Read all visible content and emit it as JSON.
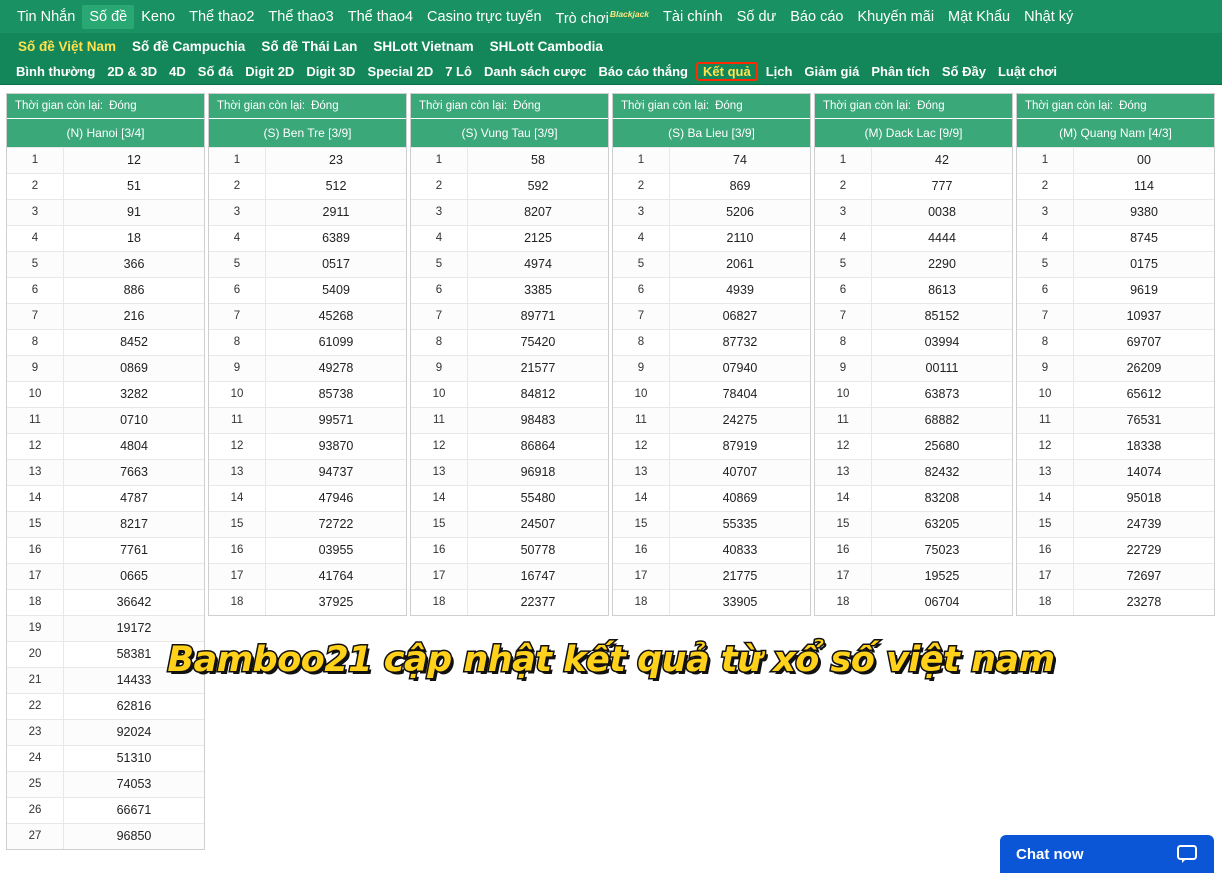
{
  "nav_primary": {
    "items": [
      {
        "label": "Tin Nhắn",
        "active": false
      },
      {
        "label": "Số đề",
        "active": true
      },
      {
        "label": "Keno",
        "active": false
      },
      {
        "label": "Thể thao2",
        "active": false
      },
      {
        "label": "Thể thao3",
        "active": false
      },
      {
        "label": "Thể thao4",
        "active": false
      },
      {
        "label": "Casino trực tuyến",
        "active": false
      },
      {
        "label": "Trò chơi",
        "badge": "Blackjack",
        "active": false
      },
      {
        "label": "Tài chính",
        "active": false
      },
      {
        "label": "Số dư",
        "active": false
      },
      {
        "label": "Báo cáo",
        "active": false
      },
      {
        "label": "Khuyến mãi",
        "active": false
      },
      {
        "label": "Mật Khẩu",
        "active": false
      },
      {
        "label": "Nhật ký",
        "active": false
      }
    ]
  },
  "nav_secondary": {
    "items": [
      {
        "label": "Số đề Việt Nam",
        "active": true
      },
      {
        "label": "Số đề Campuchia",
        "active": false
      },
      {
        "label": "Số đề Thái Lan",
        "active": false
      },
      {
        "label": "SHLott Vietnam",
        "active": false
      },
      {
        "label": "SHLott Cambodia",
        "active": false
      }
    ]
  },
  "nav_tertiary": {
    "items": [
      {
        "label": "Bình thường",
        "highlight": false
      },
      {
        "label": "2D & 3D",
        "highlight": false
      },
      {
        "label": "4D",
        "highlight": false
      },
      {
        "label": "Số đá",
        "highlight": false
      },
      {
        "label": "Digit 2D",
        "highlight": false
      },
      {
        "label": "Digit 3D",
        "highlight": false
      },
      {
        "label": "Special 2D",
        "highlight": false
      },
      {
        "label": "7 Lô",
        "highlight": false
      },
      {
        "label": "Danh sách cược",
        "highlight": false
      },
      {
        "label": "Báo cáo thắng",
        "highlight": false
      },
      {
        "label": "Kết quả",
        "highlight": true
      },
      {
        "label": "Lịch",
        "highlight": false
      },
      {
        "label": "Giảm giá",
        "highlight": false
      },
      {
        "label": "Phân tích",
        "highlight": false
      },
      {
        "label": "Số Đầy",
        "highlight": false
      },
      {
        "label": "Luật chơi",
        "highlight": false
      }
    ]
  },
  "timer_label": "Thời gian còn lại:",
  "timer_value": "Đóng",
  "cards": [
    {
      "title": "(N) Hanoi [3/4]",
      "timer_label": "Thời gian còn lại:",
      "timer_value": "Đóng",
      "rows": [
        {
          "idx": "1",
          "val": "12"
        },
        {
          "idx": "2",
          "val": "51"
        },
        {
          "idx": "3",
          "val": "91"
        },
        {
          "idx": "4",
          "val": "18"
        },
        {
          "idx": "5",
          "val": "366"
        },
        {
          "idx": "6",
          "val": "886"
        },
        {
          "idx": "7",
          "val": "216"
        },
        {
          "idx": "8",
          "val": "8452"
        },
        {
          "idx": "9",
          "val": "0869"
        },
        {
          "idx": "10",
          "val": "3282"
        },
        {
          "idx": "11",
          "val": "0710"
        },
        {
          "idx": "12",
          "val": "4804"
        },
        {
          "idx": "13",
          "val": "7663"
        },
        {
          "idx": "14",
          "val": "4787"
        },
        {
          "idx": "15",
          "val": "8217"
        },
        {
          "idx": "16",
          "val": "7761"
        },
        {
          "idx": "17",
          "val": "0665"
        },
        {
          "idx": "18",
          "val": "36642"
        },
        {
          "idx": "19",
          "val": "19172"
        },
        {
          "idx": "20",
          "val": "58381"
        },
        {
          "idx": "21",
          "val": "14433"
        },
        {
          "idx": "22",
          "val": "62816"
        },
        {
          "idx": "23",
          "val": "92024"
        },
        {
          "idx": "24",
          "val": "51310"
        },
        {
          "idx": "25",
          "val": "74053"
        },
        {
          "idx": "26",
          "val": "66671"
        },
        {
          "idx": "27",
          "val": "96850"
        }
      ]
    },
    {
      "title": "(S) Ben Tre [3/9]",
      "timer_label": "Thời gian còn lại:",
      "timer_value": "Đóng",
      "rows": [
        {
          "idx": "1",
          "val": "23"
        },
        {
          "idx": "2",
          "val": "512"
        },
        {
          "idx": "3",
          "val": "2911"
        },
        {
          "idx": "4",
          "val": "6389"
        },
        {
          "idx": "5",
          "val": "0517"
        },
        {
          "idx": "6",
          "val": "5409"
        },
        {
          "idx": "7",
          "val": "45268"
        },
        {
          "idx": "8",
          "val": "61099"
        },
        {
          "idx": "9",
          "val": "49278"
        },
        {
          "idx": "10",
          "val": "85738"
        },
        {
          "idx": "11",
          "val": "99571"
        },
        {
          "idx": "12",
          "val": "93870"
        },
        {
          "idx": "13",
          "val": "94737"
        },
        {
          "idx": "14",
          "val": "47946"
        },
        {
          "idx": "15",
          "val": "72722"
        },
        {
          "idx": "16",
          "val": "03955"
        },
        {
          "idx": "17",
          "val": "41764"
        },
        {
          "idx": "18",
          "val": "37925"
        }
      ]
    },
    {
      "title": "(S) Vung Tau [3/9]",
      "timer_label": "Thời gian còn lại:",
      "timer_value": "Đóng",
      "rows": [
        {
          "idx": "1",
          "val": "58"
        },
        {
          "idx": "2",
          "val": "592"
        },
        {
          "idx": "3",
          "val": "8207"
        },
        {
          "idx": "4",
          "val": "2125"
        },
        {
          "idx": "5",
          "val": "4974"
        },
        {
          "idx": "6",
          "val": "3385"
        },
        {
          "idx": "7",
          "val": "89771"
        },
        {
          "idx": "8",
          "val": "75420"
        },
        {
          "idx": "9",
          "val": "21577"
        },
        {
          "idx": "10",
          "val": "84812"
        },
        {
          "idx": "11",
          "val": "98483"
        },
        {
          "idx": "12",
          "val": "86864"
        },
        {
          "idx": "13",
          "val": "96918"
        },
        {
          "idx": "14",
          "val": "55480"
        },
        {
          "idx": "15",
          "val": "24507"
        },
        {
          "idx": "16",
          "val": "50778"
        },
        {
          "idx": "17",
          "val": "16747"
        },
        {
          "idx": "18",
          "val": "22377"
        }
      ]
    },
    {
      "title": "(S) Ba Lieu [3/9]",
      "timer_label": "Thời gian còn lại:",
      "timer_value": "Đóng",
      "rows": [
        {
          "idx": "1",
          "val": "74"
        },
        {
          "idx": "2",
          "val": "869"
        },
        {
          "idx": "3",
          "val": "5206"
        },
        {
          "idx": "4",
          "val": "2110"
        },
        {
          "idx": "5",
          "val": "2061"
        },
        {
          "idx": "6",
          "val": "4939"
        },
        {
          "idx": "7",
          "val": "06827"
        },
        {
          "idx": "8",
          "val": "87732"
        },
        {
          "idx": "9",
          "val": "07940"
        },
        {
          "idx": "10",
          "val": "78404"
        },
        {
          "idx": "11",
          "val": "24275"
        },
        {
          "idx": "12",
          "val": "87919"
        },
        {
          "idx": "13",
          "val": "40707"
        },
        {
          "idx": "14",
          "val": "40869"
        },
        {
          "idx": "15",
          "val": "55335"
        },
        {
          "idx": "16",
          "val": "40833"
        },
        {
          "idx": "17",
          "val": "21775"
        },
        {
          "idx": "18",
          "val": "33905"
        }
      ]
    },
    {
      "title": "(M) Dack Lac [9/9]",
      "timer_label": "Thời gian còn lại:",
      "timer_value": "Đóng",
      "rows": [
        {
          "idx": "1",
          "val": "42"
        },
        {
          "idx": "2",
          "val": "777"
        },
        {
          "idx": "3",
          "val": "0038"
        },
        {
          "idx": "4",
          "val": "4444"
        },
        {
          "idx": "5",
          "val": "2290"
        },
        {
          "idx": "6",
          "val": "8613"
        },
        {
          "idx": "7",
          "val": "85152"
        },
        {
          "idx": "8",
          "val": "03994"
        },
        {
          "idx": "9",
          "val": "00111"
        },
        {
          "idx": "10",
          "val": "63873"
        },
        {
          "idx": "11",
          "val": "68882"
        },
        {
          "idx": "12",
          "val": "25680"
        },
        {
          "idx": "13",
          "val": "82432"
        },
        {
          "idx": "14",
          "val": "83208"
        },
        {
          "idx": "15",
          "val": "63205"
        },
        {
          "idx": "16",
          "val": "75023"
        },
        {
          "idx": "17",
          "val": "19525"
        },
        {
          "idx": "18",
          "val": "06704"
        }
      ]
    },
    {
      "title": "(M) Quang Nam [4/3]",
      "timer_label": "Thời gian còn lại:",
      "timer_value": "Đóng",
      "rows": [
        {
          "idx": "1",
          "val": "00"
        },
        {
          "idx": "2",
          "val": "114"
        },
        {
          "idx": "3",
          "val": "9380"
        },
        {
          "idx": "4",
          "val": "8745"
        },
        {
          "idx": "5",
          "val": "0175"
        },
        {
          "idx": "6",
          "val": "9619"
        },
        {
          "idx": "7",
          "val": "10937"
        },
        {
          "idx": "8",
          "val": "69707"
        },
        {
          "idx": "9",
          "val": "26209"
        },
        {
          "idx": "10",
          "val": "65612"
        },
        {
          "idx": "11",
          "val": "76531"
        },
        {
          "idx": "12",
          "val": "18338"
        },
        {
          "idx": "13",
          "val": "14074"
        },
        {
          "idx": "14",
          "val": "95018"
        },
        {
          "idx": "15",
          "val": "24739"
        },
        {
          "idx": "16",
          "val": "22729"
        },
        {
          "idx": "17",
          "val": "72697"
        },
        {
          "idx": "18",
          "val": "23278"
        }
      ]
    }
  ],
  "banner": {
    "text": "Bamboo21 cập nhật kết quả từ xổ số việt nam"
  },
  "chat": {
    "label": "Chat now",
    "icon": "chat-bubble-icon"
  },
  "colors": {
    "nav_primary_bg": "#1a9162",
    "nav_secondary_bg": "#14875a",
    "card_header_bg": "#3aa878",
    "highlight_border": "#ff2a00",
    "highlight_text": "#ffe14d",
    "banner_text": "#ffd11a",
    "chat_bg": "#0a56d6"
  }
}
